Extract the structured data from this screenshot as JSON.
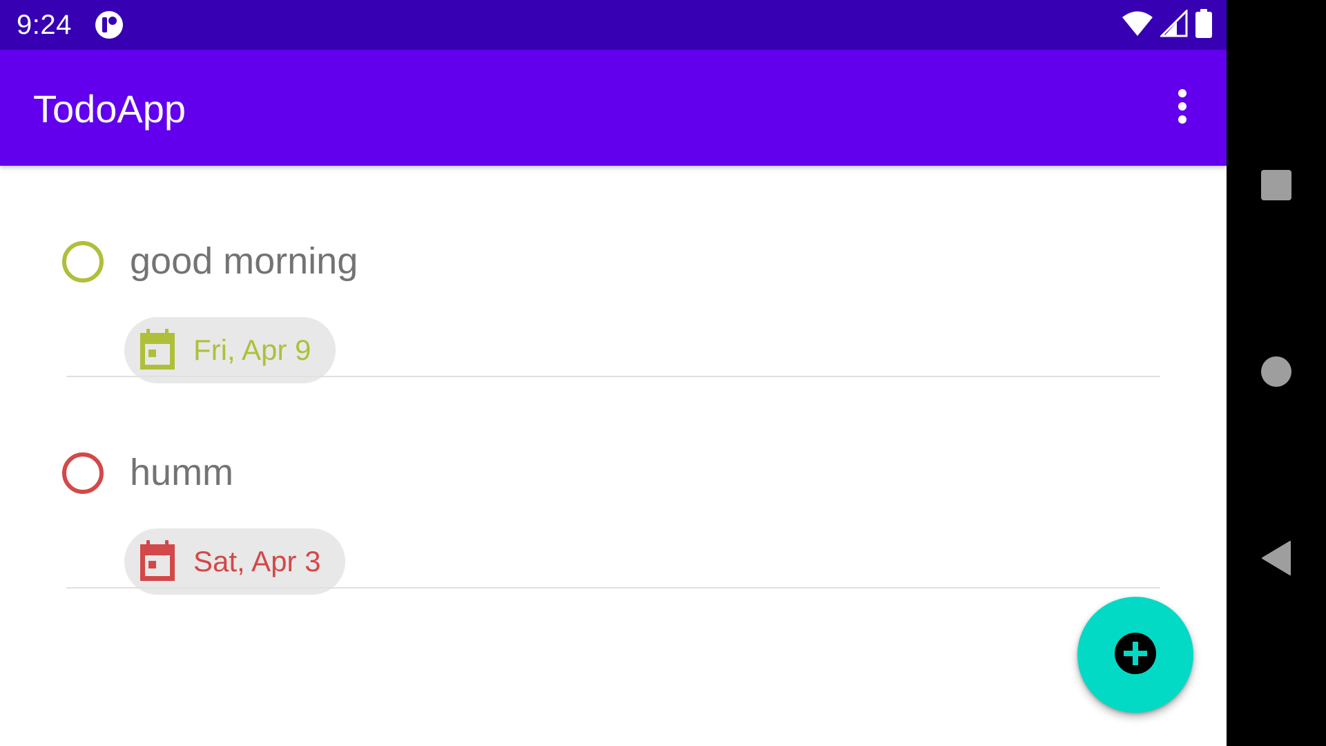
{
  "status_bar": {
    "time": "9:24",
    "app_icon": "notification-app-icon",
    "icons": [
      "wifi-icon",
      "cell-signal-icon",
      "battery-icon"
    ]
  },
  "app_bar": {
    "title": "TodoApp",
    "menu_icon": "more-vert-icon"
  },
  "todos": [
    {
      "title": "good morning",
      "due_date": "Fri, Apr 9",
      "completed": false,
      "accent_color": "#afbf3a",
      "icon": "calendar-icon"
    },
    {
      "title": "humm",
      "due_date": "Sat, Apr 3",
      "completed": false,
      "accent_color": "#d34848",
      "icon": "calendar-icon"
    }
  ],
  "fab": {
    "icon": "add-circle-icon",
    "color": "#03dac5"
  },
  "nav_bar": {
    "buttons": [
      "recents-square-icon",
      "home-circle-icon",
      "back-triangle-icon"
    ]
  },
  "colors": {
    "status_bar": "#3700b3",
    "primary": "#6200ee",
    "chip_background": "#e8e8e8",
    "text_secondary": "#737373"
  }
}
